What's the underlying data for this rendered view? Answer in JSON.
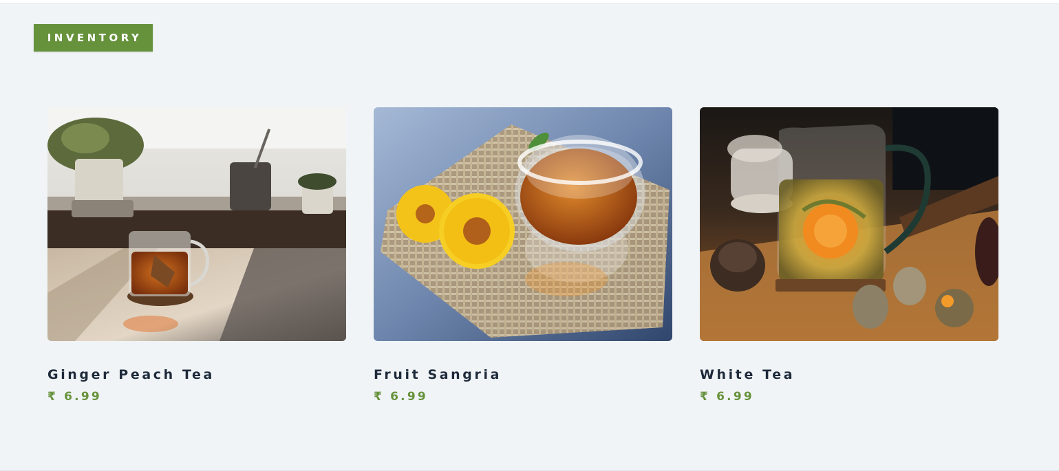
{
  "section": {
    "label": "INVENTORY"
  },
  "products": [
    {
      "name": "Ginger Peach Tea",
      "price": "₹ 6.99",
      "image": "tea-cup-on-windowsill-photo"
    },
    {
      "name": "Fruit Sangria",
      "price": "₹ 6.99",
      "image": "tea-glass-with-yellow-flowers-photo"
    },
    {
      "name": "White Tea",
      "price": "₹ 6.99",
      "image": "blooming-tea-in-glass-pitcher-photo"
    }
  ],
  "colors": {
    "accent": "#67923c",
    "background": "#f0f4f7",
    "title_text": "#1e2a3a"
  }
}
